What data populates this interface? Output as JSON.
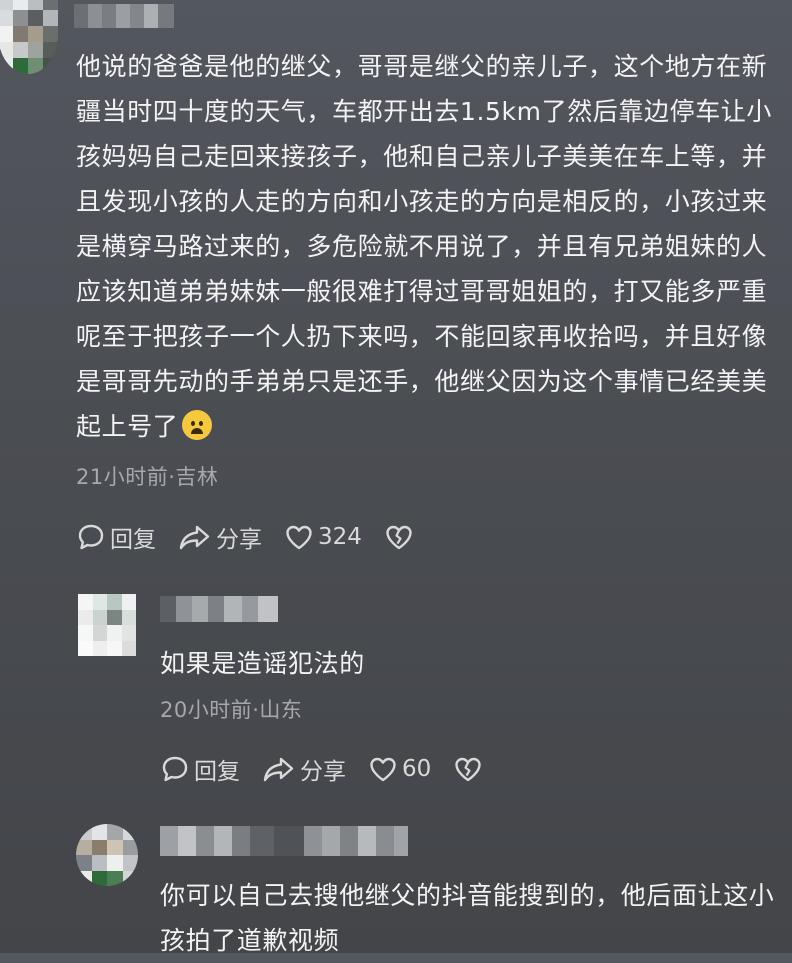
{
  "comments": [
    {
      "text": "他说的爸爸是他的继父，哥哥是继父的亲儿子，这个地方在新疆当时四十度的天气，车都开出去1.5km了然后靠边停车让小孩妈妈自己走回来接孩子，他和自己亲儿子美美在车上等，并且发现小孩的人走的方向和小孩走的方向是相反的，小孩过来是横穿马路过来的，多危险就不用说了，并且有兄弟姐妹的人应该知道弟弟妹妹一般很难打得过哥哥姐姐的，打又能多严重呢至于把孩子一个人扔下来吗，不能回家再收拾吗，并且好像是哥哥先动的手弟弟只是还手，他继父因为这个事情已经美美起上号了",
      "emoji_icon": "worried-face-icon",
      "meta": "21小时前·吉林",
      "reply_label": "回复",
      "share_label": "分享",
      "likes": "324"
    },
    {
      "text": "如果是造谣犯法的",
      "meta": "20小时前·山东",
      "reply_label": "回复",
      "share_label": "分享",
      "likes": "60"
    },
    {
      "text": "你可以自己去搜他继父的抖音能搜到的，他后面让这小孩拍了道歉视频"
    }
  ],
  "colors": {
    "background": "#4a4d52",
    "text": "#f3f3f3",
    "meta": "#a6a8ad"
  }
}
